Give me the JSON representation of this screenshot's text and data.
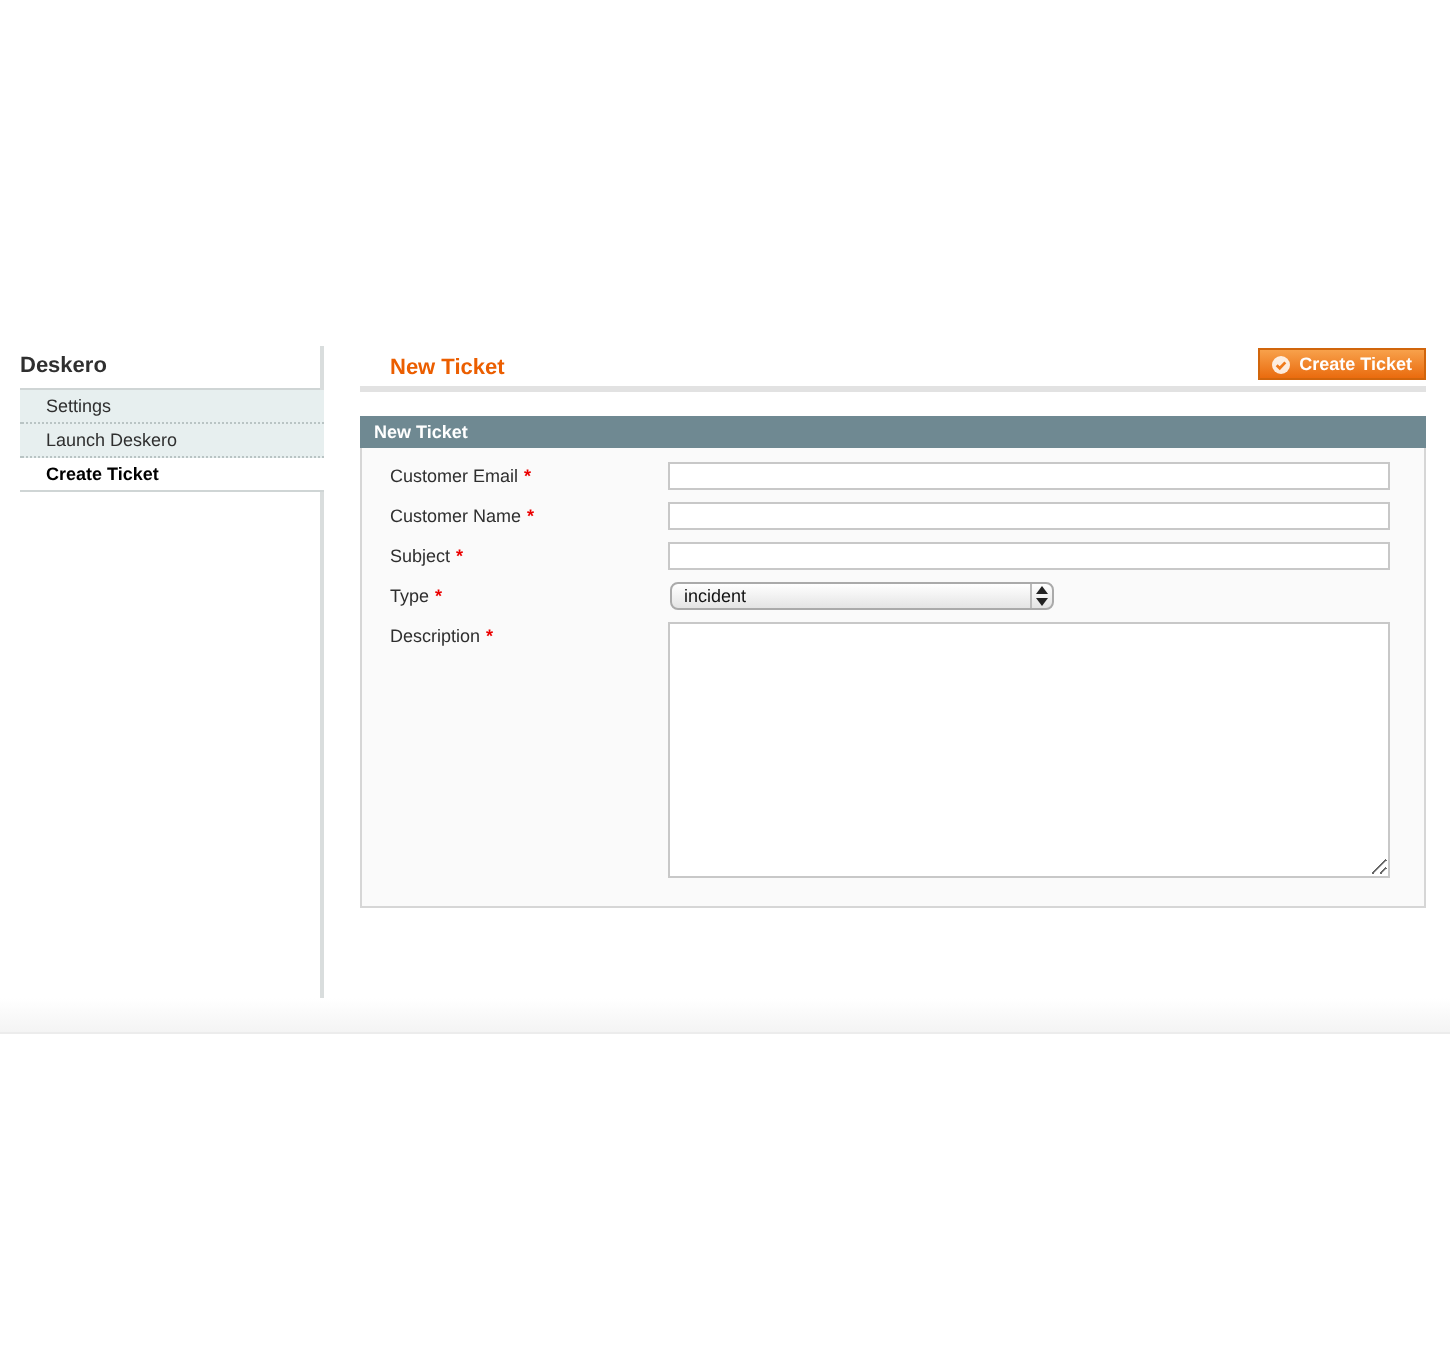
{
  "sidebar": {
    "title": "Deskero",
    "items": [
      {
        "label": "Settings",
        "selected": false
      },
      {
        "label": "Launch Deskero",
        "selected": false
      },
      {
        "label": "Create Ticket",
        "selected": true
      }
    ]
  },
  "page": {
    "title": "New Ticket",
    "action_button": "Create Ticket"
  },
  "form": {
    "title": "New Ticket",
    "fields": [
      {
        "kind": "text",
        "label": "Customer Email",
        "required_mark": "*"
      },
      {
        "kind": "text",
        "label": "Customer Name",
        "required_mark": "*"
      },
      {
        "kind": "text",
        "label": "Subject",
        "required_mark": "*"
      },
      {
        "kind": "select",
        "label": "Type",
        "required_mark": "*",
        "value": "incident"
      },
      {
        "kind": "textarea",
        "label": "Description",
        "required_mark": "*"
      }
    ]
  }
}
